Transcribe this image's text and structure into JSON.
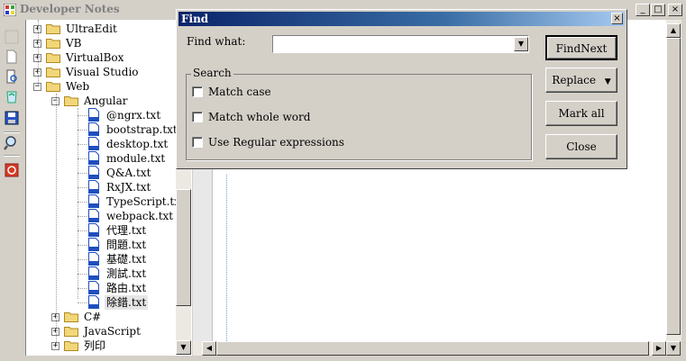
{
  "window": {
    "title": "Developer Notes",
    "controls": [
      "_",
      "□",
      "×"
    ]
  },
  "toolbar": {
    "icons": [
      "dotted-icon",
      "new-document-icon",
      "print-preview-icon",
      "recycle-icon",
      "save-icon",
      "search-icon",
      "close-red-icon"
    ]
  },
  "tree": {
    "items": [
      {
        "label": "UltraEdit",
        "kind": "folder",
        "level": 0,
        "expander": "+"
      },
      {
        "label": "VB",
        "kind": "folder",
        "level": 0,
        "expander": "+"
      },
      {
        "label": "VirtualBox",
        "kind": "folder",
        "level": 0,
        "expander": "+"
      },
      {
        "label": "Visual Studio",
        "kind": "folder",
        "level": 0,
        "expander": "+"
      },
      {
        "label": "Web",
        "kind": "folder",
        "level": 0,
        "expander": "-"
      },
      {
        "label": "Angular",
        "kind": "folder",
        "level": 1,
        "expander": "-"
      },
      {
        "label": "@ngrx.txt",
        "kind": "file",
        "level": 2
      },
      {
        "label": "bootstrap.txt",
        "kind": "file",
        "level": 2
      },
      {
        "label": "desktop.txt",
        "kind": "file",
        "level": 2
      },
      {
        "label": "module.txt",
        "kind": "file",
        "level": 2
      },
      {
        "label": "Q&A.txt",
        "kind": "file",
        "level": 2
      },
      {
        "label": "RxJX.txt",
        "kind": "file",
        "level": 2
      },
      {
        "label": "TypeScript.txt",
        "kind": "file",
        "level": 2
      },
      {
        "label": "webpack.txt",
        "kind": "file",
        "level": 2
      },
      {
        "label": "代理.txt",
        "kind": "file",
        "level": 2
      },
      {
        "label": "問題.txt",
        "kind": "file",
        "level": 2
      },
      {
        "label": "基礎.txt",
        "kind": "file",
        "level": 2
      },
      {
        "label": "測試.txt",
        "kind": "file",
        "level": 2
      },
      {
        "label": "路由.txt",
        "kind": "file",
        "level": 2
      },
      {
        "label": "除錯.txt",
        "kind": "file",
        "level": 2,
        "selected": true
      },
      {
        "label": "C#",
        "kind": "folder",
        "level": 1,
        "expander": "+"
      },
      {
        "label": "JavaScript",
        "kind": "folder",
        "level": 1,
        "expander": "+"
      },
      {
        "label": "列印",
        "kind": "folder",
        "level": 1,
        "expander": "+"
      }
    ]
  },
  "find_dialog": {
    "title": "Find",
    "close": "×",
    "find_what_label": "Find what:",
    "find_what_value": "",
    "dropdown_arrow": "▼",
    "search_group_label": "Search",
    "options": [
      {
        "label": "Match case",
        "checked": false
      },
      {
        "label": "Match whole word",
        "checked": false
      },
      {
        "label": "Use Regular expressions",
        "checked": false
      }
    ],
    "buttons": {
      "find_next": "FindNext",
      "replace": "Replace",
      "replace_arrow": "▼",
      "mark_all": "Mark all",
      "close": "Close"
    }
  },
  "colors": {
    "face": "#d4d0c8",
    "dialog_title_start": "#0a246a",
    "dialog_title_end": "#a6caf0",
    "folder": "#f2d77a",
    "file": "#1f4fbf"
  }
}
